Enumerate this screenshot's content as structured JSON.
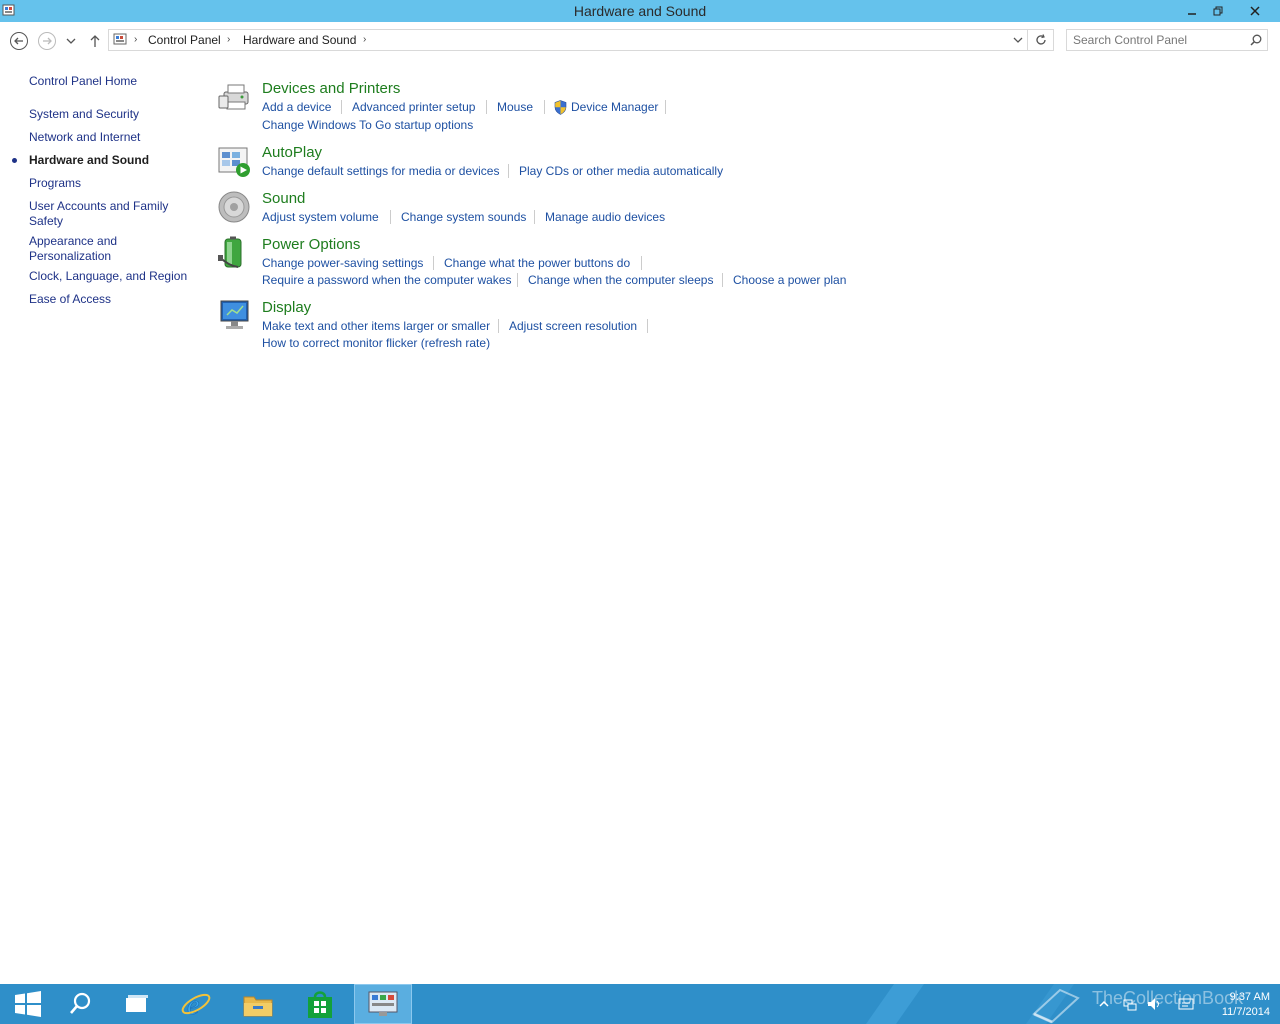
{
  "window": {
    "title": "Hardware and Sound"
  },
  "address_bar": {
    "breadcrumbs": [
      "Control Panel",
      "Hardware and Sound"
    ],
    "search_placeholder": "Search Control Panel"
  },
  "sidebar": {
    "home": "Control Panel Home",
    "items": [
      {
        "label": "System and Security"
      },
      {
        "label": "Network and Internet"
      },
      {
        "label": "Hardware and Sound",
        "active": true
      },
      {
        "label": "Programs"
      },
      {
        "label": "User Accounts and Family Safety"
      },
      {
        "label": "Appearance and Personalization"
      },
      {
        "label": "Clock, Language, and Region"
      },
      {
        "label": "Ease of Access"
      }
    ]
  },
  "categories": [
    {
      "title": "Devices and Printers",
      "icon": "printer-icon",
      "links": [
        "Add a device",
        "Advanced printer setup",
        "Mouse",
        "Device Manager",
        "Change Windows To Go startup options"
      ]
    },
    {
      "title": "AutoPlay",
      "icon": "autoplay-icon",
      "links": [
        "Change default settings for media or devices",
        "Play CDs or other media automatically"
      ]
    },
    {
      "title": "Sound",
      "icon": "speaker-icon",
      "links": [
        "Adjust system volume",
        "Change system sounds",
        "Manage audio devices"
      ]
    },
    {
      "title": "Power Options",
      "icon": "battery-icon",
      "links": [
        "Change power-saving settings",
        "Change what the power buttons do",
        "Require a password when the computer wakes",
        "Change when the computer sleeps",
        "Choose a power plan"
      ]
    },
    {
      "title": "Display",
      "icon": "monitor-icon",
      "links": [
        "Make text and other items larger or smaller",
        "Adjust screen resolution",
        "How to correct monitor flicker (refresh rate)"
      ]
    }
  ],
  "taskbar": {
    "watermark": "TheCollectionBook",
    "clock_time": "9:37 AM",
    "clock_date": "11/7/2014"
  },
  "colors": {
    "titlebar": "#65c2ec",
    "taskbar": "#2f8fc9",
    "heading_green": "#1e7d1e",
    "link_blue": "#1e50a2"
  }
}
